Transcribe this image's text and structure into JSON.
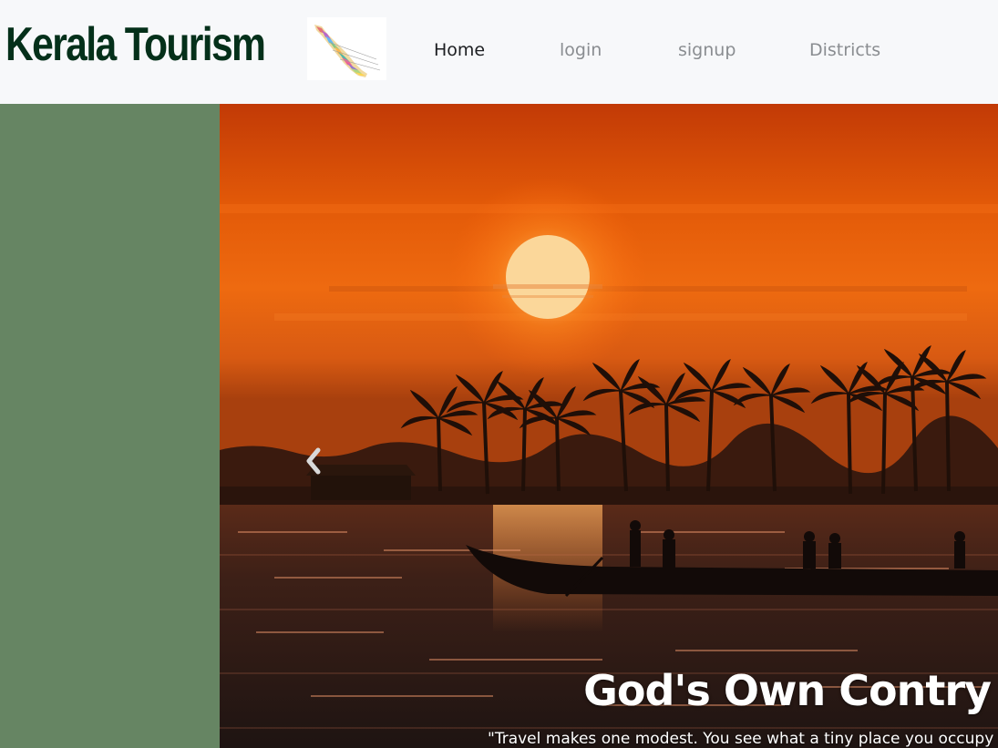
{
  "navbar": {
    "brand": "Kerala Tourism",
    "logo_icon": "kerala-map-icon",
    "links": [
      {
        "label": "Home",
        "active": true
      },
      {
        "label": "login",
        "active": false
      },
      {
        "label": "signup",
        "active": false
      },
      {
        "label": "Districts",
        "active": false
      }
    ]
  },
  "sidebar": {
    "color": "#668563"
  },
  "carousel": {
    "prev_icon": "chevron-left-icon",
    "caption_title": "God's Own Contry",
    "caption_text": "\"Travel makes one modest. You see what a tiny place you occupy"
  },
  "colors": {
    "brand": "#04301a",
    "nav_bg": "#f7f8fa",
    "sidebar": "#668563",
    "sunset_orange": "#e85a06"
  }
}
